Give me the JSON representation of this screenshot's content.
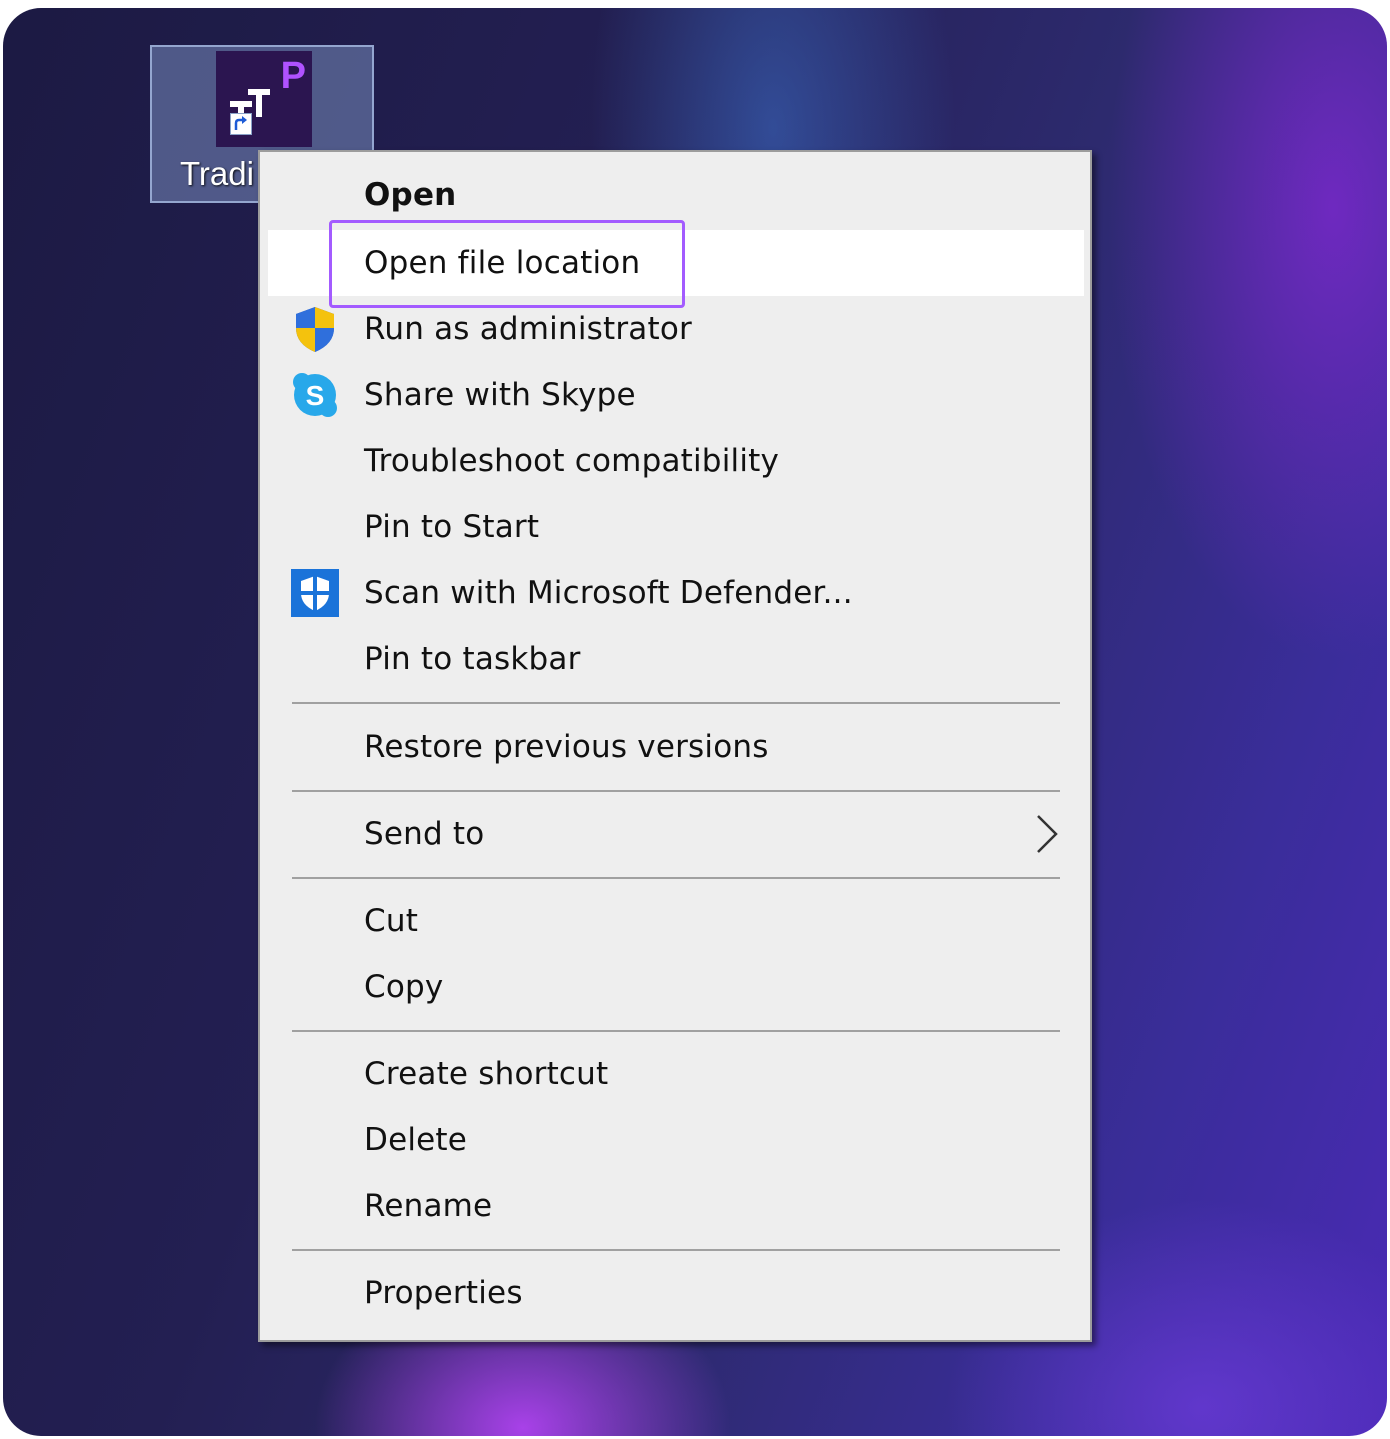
{
  "desktop": {
    "icon_label": "Tradi",
    "icon_badge": "P",
    "icon_name": "trading-app-shortcut-icon"
  },
  "context_menu": {
    "items": [
      {
        "label": "Open",
        "bold": true
      },
      {
        "label": "Open file location",
        "hovered": true
      },
      {
        "label": "Run as administrator",
        "icon": "uac-shield-icon"
      },
      {
        "label": "Share with Skype",
        "icon": "skype-icon"
      },
      {
        "label": "Troubleshoot compatibility"
      },
      {
        "label": "Pin to Start"
      },
      {
        "label": "Scan with Microsoft Defender...",
        "icon": "defender-shield-icon"
      },
      {
        "label": "Pin to taskbar"
      },
      {
        "label": "Restore previous versions"
      },
      {
        "label": "Send to",
        "submenu": true,
        "icon": "chevron-right-icon"
      },
      {
        "label": "Cut"
      },
      {
        "label": "Copy"
      },
      {
        "label": "Create shortcut"
      },
      {
        "label": "Delete"
      },
      {
        "label": "Rename"
      },
      {
        "label": "Properties"
      }
    ]
  },
  "colors": {
    "highlight_outline": "#a35bff",
    "menu_background": "#eeeeee",
    "hover_background": "#ffffff"
  }
}
